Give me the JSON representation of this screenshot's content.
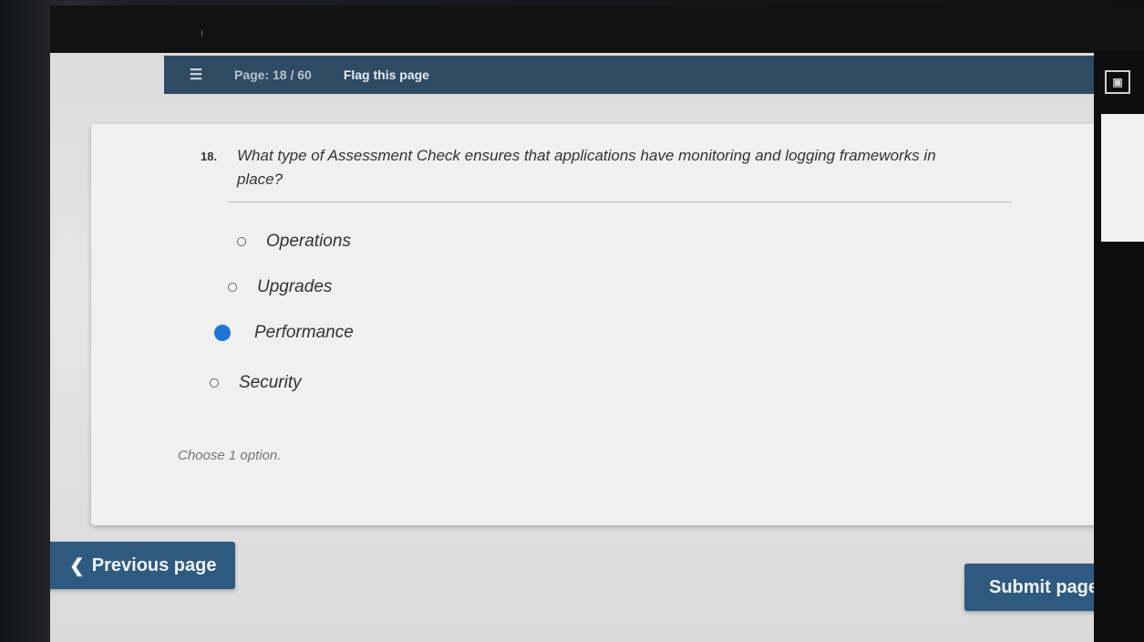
{
  "app": {
    "top_text": "!"
  },
  "navbar": {
    "menu_icon": "menu-icon",
    "page_label": "Page: 18 / 60",
    "flag_label": "Flag this page"
  },
  "question": {
    "number": "18.",
    "text": "What type of Assessment Check ensures that applications have monitoring and logging frameworks in place?",
    "options": [
      {
        "label": "Operations",
        "selected": false
      },
      {
        "label": "Upgrades",
        "selected": false
      },
      {
        "label": "Performance",
        "selected": true
      },
      {
        "label": "Security",
        "selected": false
      }
    ],
    "hint": "Choose 1 option."
  },
  "buttons": {
    "previous": "Previous page",
    "submit": "Submit page"
  },
  "colors": {
    "navbar": "#2f4a63",
    "button": "#2f5a7f",
    "selected_radio": "#1f74d8"
  }
}
